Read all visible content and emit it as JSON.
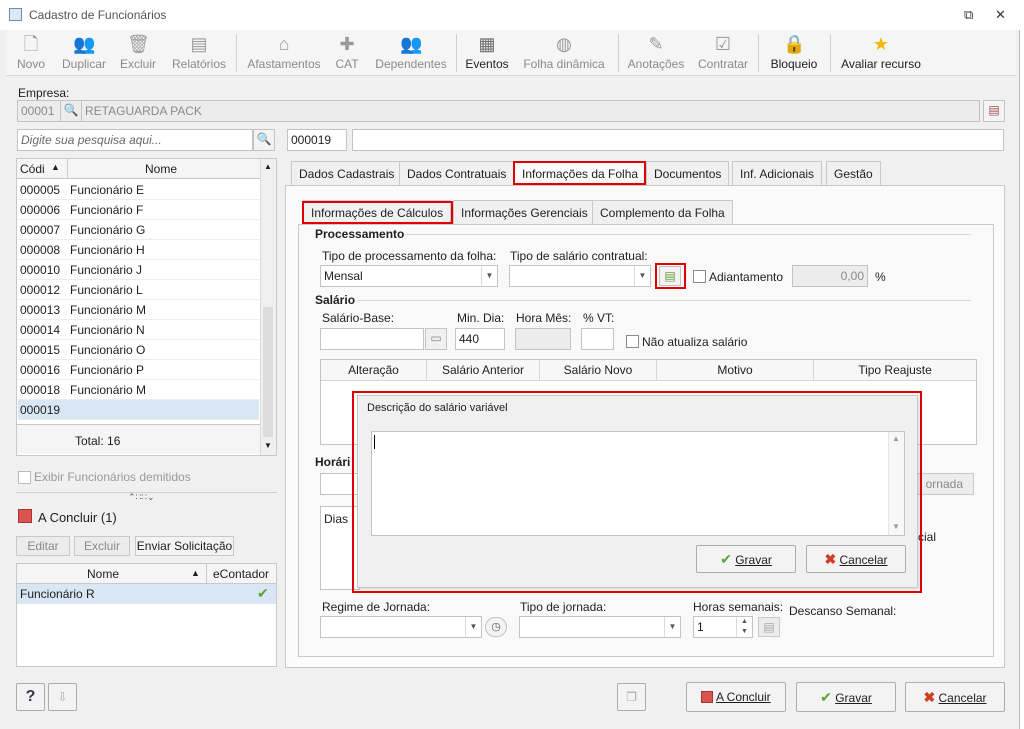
{
  "window": {
    "title": "Cadastro de Funcionários",
    "restore_glyph": "⧉",
    "close_glyph": "✕"
  },
  "toolbar": {
    "novo": "Novo",
    "duplicar": "Duplicar",
    "excluir": "Excluir",
    "relatorios": "Relatórios",
    "afastamentos": "Afastamentos",
    "cat": "CAT",
    "dependentes": "Dependentes",
    "eventos": "Eventos",
    "folha_dinamica": "Folha dinâmica",
    "anotacoes": "Anotações",
    "contratar": "Contratar",
    "bloqueio": "Bloqueio",
    "avaliar_recurso": "Avaliar recurso"
  },
  "empresa": {
    "label": "Empresa:",
    "code": "00001",
    "name": "RETAGUARDA PACK"
  },
  "search": {
    "placeholder": "Digite sua pesquisa aqui...",
    "code": "000019",
    "name": ""
  },
  "employee_list": {
    "col_code": "Códi",
    "col_name": "Nome",
    "rows": [
      {
        "code": "000005",
        "name": "Funcionário E"
      },
      {
        "code": "000006",
        "name": "Funcionário F"
      },
      {
        "code": "000007",
        "name": "Funcionário G"
      },
      {
        "code": "000008",
        "name": "Funcionário H"
      },
      {
        "code": "000010",
        "name": "Funcionário J"
      },
      {
        "code": "000012",
        "name": "Funcionário L"
      },
      {
        "code": "000013",
        "name": "Funcionário M"
      },
      {
        "code": "000014",
        "name": "Funcionário N"
      },
      {
        "code": "000015",
        "name": "Funcionário O"
      },
      {
        "code": "000016",
        "name": "Funcionário P"
      },
      {
        "code": "000018",
        "name": "Funcionário M"
      },
      {
        "code": "000019",
        "name": ""
      }
    ],
    "total": "Total: 16"
  },
  "exibir_demitidos": "Exibir Funcionários demitidos",
  "a_concluir": {
    "title": "A Concluir (1)",
    "editar": "Editar",
    "excluir": "Excluir",
    "enviar": "Enviar Solicitação",
    "col_nome": "Nome",
    "col_econtador": "eContador",
    "rows": [
      {
        "nome": "Funcionário R"
      }
    ]
  },
  "tabs": {
    "dados_cadastrais": "Dados Cadastrais",
    "dados_contratuais": "Dados Contratuais",
    "informacoes_folha": "Informações da Folha",
    "documentos": "Documentos",
    "inf_adicionais": "Inf. Adicionais",
    "gestao": "Gestão"
  },
  "subtabs": {
    "calculos": "Informações de Cálculos",
    "gerenciais": "Informações Gerenciais",
    "complemento": "Complemento da Folha"
  },
  "processamento": {
    "title": "Processamento",
    "tipo_proc_label": "Tipo de processamento da folha:",
    "tipo_proc_value": "Mensal",
    "tipo_sal_label": "Tipo de salário contratual:",
    "tipo_sal_value": "",
    "adiantamento": "Adiantamento",
    "adiantamento_value": "0,00",
    "percent": "%"
  },
  "salario": {
    "title": "Salário",
    "base_label": "Salário-Base:",
    "min_dia_label": "Min. Dia:",
    "min_dia_value": "440",
    "hora_mes_label": "Hora Mês:",
    "vt_label": "% VT:",
    "nao_atualiza": "Não atualiza salário",
    "grid_cols": [
      "Alteração",
      "Salário Anterior",
      "Salário Novo",
      "Motivo",
      "Tipo Reajuste"
    ]
  },
  "horario": {
    "title": "Horári",
    "jornada_btn": "ornada",
    "dias_col": "Dias",
    "cial": "cial",
    "regime_label": "Regime de Jornada:",
    "tipo_jornada_label": "Tipo de jornada:",
    "horas_semanais_label": "Horas semanais:",
    "horas_semanais_value": "1",
    "descanso_label": "Descanso Semanal:"
  },
  "dialog": {
    "title": "Descrição do salário variável",
    "text": "",
    "gravar": "Gravar",
    "cancelar": "Cancelar"
  },
  "footer": {
    "help": "?",
    "a_concluir": "A Concluir",
    "gravar": "Gravar",
    "cancelar": "Cancelar"
  },
  "colors": {
    "highlight_red": "#e00000",
    "selected_row": "#d9e6f3",
    "check_green": "#5aa33a",
    "cancel_red": "#d04020"
  }
}
